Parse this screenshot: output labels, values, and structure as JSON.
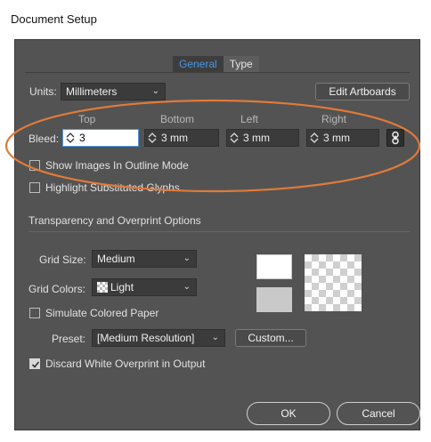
{
  "window": {
    "title": "Document Setup"
  },
  "tabs": [
    {
      "label": "General"
    },
    {
      "label": "Type"
    }
  ],
  "units": {
    "label": "Units:",
    "value": "Millimeters"
  },
  "edit_artboards": "Edit Artboards",
  "bleed": {
    "label": "Bleed:",
    "top": {
      "label": "Top",
      "value": "3"
    },
    "bottom": {
      "label": "Bottom",
      "value": "3 mm"
    },
    "left": {
      "label": "Left",
      "value": "3 mm"
    },
    "right": {
      "label": "Right",
      "value": "3 mm"
    }
  },
  "options": {
    "show_images_outline": "Show Images In Outline Mode",
    "highlight_glyphs": "Highlight Substituted Glyphs"
  },
  "transparency": {
    "section_title": "Transparency and Overprint Options",
    "grid_size": {
      "label": "Grid Size:",
      "value": "Medium"
    },
    "grid_colors": {
      "label": "Grid Colors:",
      "value": "Light"
    },
    "simulate_paper": "Simulate Colored Paper",
    "preset": {
      "label": "Preset:",
      "value": "[Medium Resolution]"
    },
    "custom_button": "Custom...",
    "discard_white": "Discard White Overprint in Output"
  },
  "buttons": {
    "ok": "OK",
    "cancel": "Cancel"
  },
  "colors": {
    "annotation_ellipse": "#e07a3a",
    "active_tab": "#4a97e4"
  }
}
